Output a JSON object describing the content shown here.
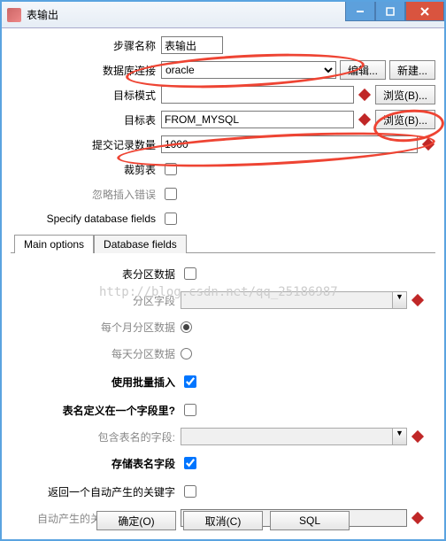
{
  "window": {
    "title": "表输出"
  },
  "winbtn": {
    "min": "—",
    "max": "□",
    "close": "✕"
  },
  "form": {
    "step_name": {
      "label": "步骤名称",
      "value": "表输出"
    },
    "db_conn": {
      "label": "数据库连接",
      "value": "oracle",
      "edit_btn": "编辑...",
      "new_btn": "新建..."
    },
    "schema": {
      "label": "目标模式",
      "value": "",
      "browse_btn": "浏览(B)..."
    },
    "table": {
      "label": "目标表",
      "value": "FROM_MYSQL",
      "browse_btn": "浏览(B)..."
    },
    "commit": {
      "label": "提交记录数量",
      "value": "1000"
    },
    "truncate": {
      "label": "裁剪表"
    },
    "ignore_err": {
      "label": "忽略插入错误"
    },
    "specify_fields": {
      "label": "Specify database fields"
    }
  },
  "tabs": {
    "main": "Main options",
    "fields": "Database fields"
  },
  "main_opts": {
    "partition": {
      "label": "表分区数据"
    },
    "part_field": {
      "label": "分区字段"
    },
    "part_month": {
      "label": "每个月分区数据"
    },
    "part_day": {
      "label": "每天分区数据"
    },
    "batch_insert": {
      "label": "使用批量插入"
    },
    "name_in_field": {
      "label": "表名定义在一个字段里?"
    },
    "name_field": {
      "label": "包含表名的字段:"
    },
    "store_name": {
      "label": "存储表名字段"
    },
    "return_key": {
      "label": "返回一个自动产生的关键字"
    },
    "key_field": {
      "label": "自动产生的关键字的字段名称"
    }
  },
  "footer": {
    "ok": "确定(O)",
    "cancel": "取消(C)",
    "sql": "SQL"
  },
  "watermark": "http://blog.csdn.net/qq_25186987"
}
